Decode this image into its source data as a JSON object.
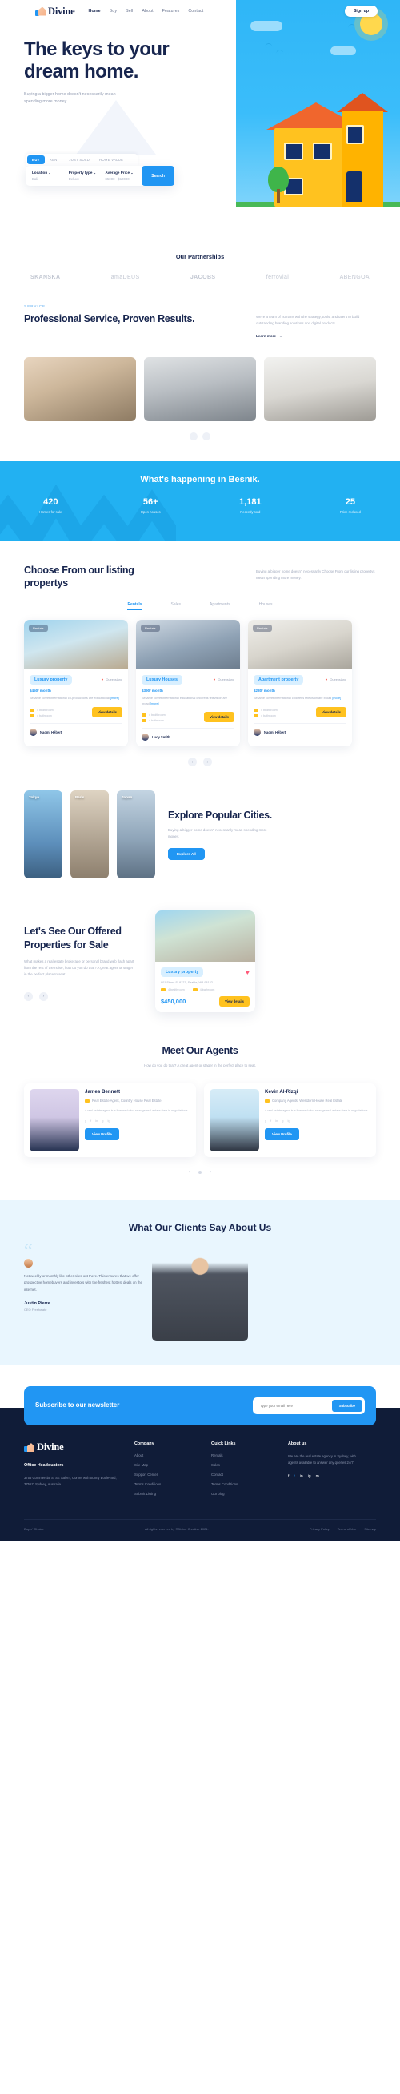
{
  "brand": {
    "name": "Divine",
    "logo_icon": "house-logo-icon"
  },
  "nav": {
    "items": [
      {
        "label": "Home",
        "active": true
      },
      {
        "label": "Buy",
        "active": false
      },
      {
        "label": "Sell",
        "active": false
      },
      {
        "label": "About",
        "active": false
      },
      {
        "label": "Features",
        "active": false
      },
      {
        "label": "Contact",
        "active": false
      }
    ],
    "signup_label": "Sign up"
  },
  "hero": {
    "title": "The keys to your dream home.",
    "subtitle": "Buying a bigger home doesn't necessarily mean spending more money.",
    "search": {
      "tabs": [
        {
          "label": "BUY",
          "active": true
        },
        {
          "label": "RENT",
          "active": false
        },
        {
          "label": "JUST SOLD",
          "active": false
        },
        {
          "label": "HOME VALUE",
          "active": false
        }
      ],
      "fields": [
        {
          "label": "Location",
          "value": "Bali"
        },
        {
          "label": "Property type",
          "value": "Deluxe"
        },
        {
          "label": "Average Price",
          "value": "$5000 - $10000"
        }
      ],
      "button_label": "Search"
    }
  },
  "partnerships": {
    "title": "Our Partnerships",
    "logos": [
      "SKANSKA",
      "amaDEUS",
      "JACOBS",
      "ferrovial",
      "ABENGOA"
    ]
  },
  "service": {
    "eyebrow": "SERVICE",
    "title": "Professional Service, Proven Results.",
    "description": "We're a team of humans with the strategy, tools, and talent to build outstanding branding solutions and digital products.",
    "learn_more": "Learn more"
  },
  "stats": {
    "title": "What's happening in Besnik.",
    "items": [
      {
        "value": "420",
        "label": "Homes for sale"
      },
      {
        "value": "56+",
        "label": "Open houses"
      },
      {
        "value": "1,181",
        "label": "Recently sold"
      },
      {
        "value": "25",
        "label": "Price reduced"
      }
    ]
  },
  "listings": {
    "title": "Choose From our listing propertys",
    "description": "Buying a bigger home doesn't necessarily Choose From our listing propertys mean spending more money.",
    "tabs": [
      {
        "label": "Rentals",
        "active": true
      },
      {
        "label": "Sales",
        "active": false
      },
      {
        "label": "Apartments",
        "active": false
      },
      {
        "label": "Houses",
        "active": false
      }
    ],
    "cards": [
      {
        "image_badge": "Rentals",
        "pill": "Luxury property",
        "location": "Queensland",
        "price": "$450/ month",
        "desc": "Sesame Street international co-productions are educational",
        "more": "[more]",
        "beds": "4 bedthroom",
        "baths": "4 bathroom",
        "button": "View details",
        "agent": "Naomi Hébert"
      },
      {
        "image_badge": "Rentals",
        "pill": "Luxury Houses",
        "location": "Queensland",
        "price": "$390/ month",
        "desc": "Sesame Street international educational childrens television are broad",
        "more": "[more]",
        "beds": "4 bedthroom",
        "baths": "4 bathroom",
        "button": "View details",
        "agent": "Lucy Smith"
      },
      {
        "image_badge": "Rentals",
        "pill": "Apartment property",
        "location": "Queensland",
        "price": "$280/ month",
        "desc": "Sesame Street international childrens television are broad",
        "more": "[more]",
        "beds": "4 bedthroom",
        "baths": "4 bathroom",
        "button": "View details",
        "agent": "Naomi Hébert"
      }
    ]
  },
  "cities": {
    "title": "Explore Popular Cities.",
    "description": "Buying a bigger home doesn't necessarily mean spending more money.",
    "button": "Explore All",
    "items": [
      {
        "name": "Tokyo"
      },
      {
        "name": "Paris"
      },
      {
        "name": "Japan"
      }
    ]
  },
  "offered": {
    "title": "Let's See Our Offered Properties for Sale",
    "description": "What makes a real estate brokerage or personal brand web flash apart from the rest of the noise, how do you do that? A great agent or stager in the perfect place to seat.",
    "card": {
      "pill": "Luxury property",
      "address": "801 Stone St 8127, Seattle, WA 98122",
      "beds": "4 bedthroom",
      "baths": "4 bathroom",
      "price": "$450,000",
      "button": "View details",
      "heart_icon": "heart-icon"
    }
  },
  "agents": {
    "title": "Meet Our Agents",
    "description": "How do you do that? A great agent or stager in the perfect place to seat.",
    "cards": [
      {
        "name": "James Bennett",
        "role": "Real Estate Agent, Country House Real Estate",
        "bio": "A real estate agent is a licensed who arrange real estate their in negotiations.",
        "button": "View Profile",
        "socials": [
          "y",
          "f",
          "in",
          "g",
          "ig"
        ]
      },
      {
        "name": "Kevin Al-Rizqi",
        "role": "Company Agents, Westdorn House Real Estate",
        "bio": "A real estate agent is a licensed who arrange real estate their in negotiations.",
        "button": "View Profile",
        "socials": [
          "y",
          "f",
          "in",
          "g",
          "ig"
        ]
      }
    ]
  },
  "testimonial": {
    "title": "What Our Clients Say About Us",
    "quote_mark": "“",
    "text": "Not weekly or monthly like other sites out there. This ensures that we offer prospective homebuyers and investors with the freshest hottest deals on the internet.",
    "name": "Justin Pierre",
    "role": "CEO Freshwate"
  },
  "newsletter": {
    "title": "Subscribe to our newsletter",
    "placeholder": "Type your email here",
    "button": "Subscribe"
  },
  "footer": {
    "brand": "Divine",
    "hq_title": "Office Headquaters",
    "address": "3755 Commercial St SE Salem, Corner with Sunny Boulevard, 37557, Sydney, Australia",
    "columns": [
      {
        "title": "Company",
        "links": [
          "About",
          "Site Map",
          "Support Center",
          "Terms Conditions",
          "Submit Listing"
        ]
      },
      {
        "title": "Quick Links",
        "links": [
          "Rentals",
          "Sales",
          "Contact",
          "Terms Conditions",
          "Our blog"
        ]
      }
    ],
    "about_title": "About us",
    "about_text": "We are the real estate agency in Sydney, with agents available to answer any queries 24/7.",
    "socials": [
      "f",
      "t",
      "in",
      "ig",
      "m"
    ],
    "bottom_left": "Buyer' Choice",
    "bottom_center": "All rights reserved by ©Divine Creative 2021.",
    "bottom_links": [
      "Privacy Policy",
      "Terms of Use",
      "Sitemap"
    ]
  },
  "colors": {
    "accent": "#2196f3",
    "dark": "#17254e",
    "yellow": "#ffc21f",
    "footer_bg": "#101c38"
  }
}
